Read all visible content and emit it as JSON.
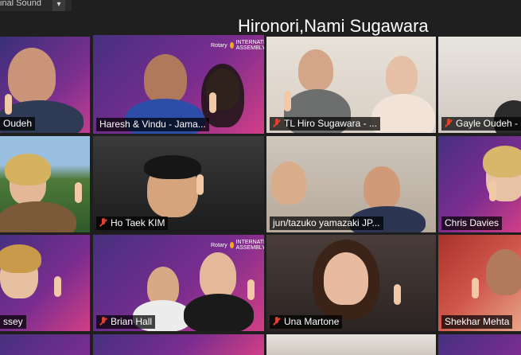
{
  "top": {
    "label": "inal Sound",
    "dropdown": "▾"
  },
  "overlay_name": "Hironori,Nami Sugawara",
  "tiles": [
    {
      "name": "Oudeh",
      "muted": false
    },
    {
      "name": "Haresh & Vindu - Jama...",
      "muted": false,
      "active": true
    },
    {
      "name": "TL Hiro Sugawara - ...",
      "muted": true
    },
    {
      "name": "Gayle Oudeh -",
      "muted": true
    },
    {
      "name": "",
      "muted": false
    },
    {
      "name": "Ho Taek KIM",
      "muted": true
    },
    {
      "name": "jun/tazuko yamazaki JP...",
      "muted": false
    },
    {
      "name": "Chris Davies",
      "muted": false
    },
    {
      "name": "ssey",
      "muted": false
    },
    {
      "name": "Brian Hall",
      "muted": true
    },
    {
      "name": "Una Martone",
      "muted": true
    },
    {
      "name": "Shekhar Mehta",
      "muted": false
    }
  ],
  "banner": {
    "brand": "Rotary",
    "sub": "INTERNATIONAL ASSEMBLY"
  },
  "colors": {
    "active_border": "#e9e24a",
    "muted_mic": "#e0402c",
    "banner_purple": "#5b2a8c"
  }
}
